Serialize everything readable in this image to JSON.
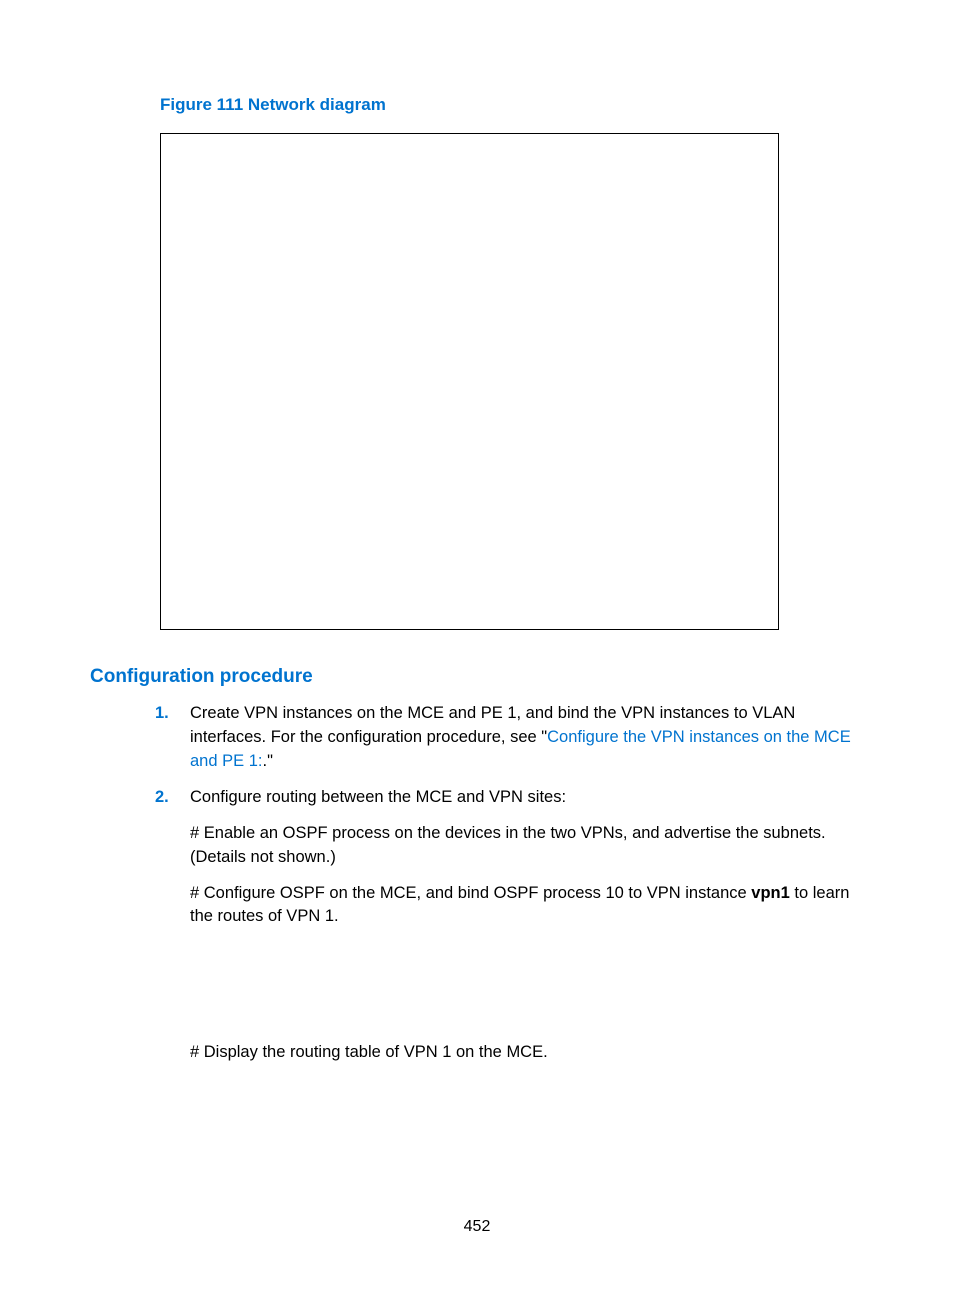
{
  "figure": {
    "caption": "Figure 111 Network diagram"
  },
  "section_heading": "Configuration procedure",
  "steps": {
    "one": {
      "num": "1.",
      "prefix": "Create VPN instances on the MCE and PE 1, and bind the VPN instances to VLAN interfaces. For the configuration procedure, see \"",
      "link_text": "Configure the VPN instances on the MCE and PE 1:",
      "suffix": ".\""
    },
    "two": {
      "num": "2.",
      "intro": "Configure routing between the MCE and VPN sites:",
      "p1": "# Enable an OSPF process on the devices in the two VPNs, and advertise the subnets. (Details not shown.)",
      "p2_prefix": "# Configure OSPF on the MCE, and bind OSPF process 10 to VPN instance ",
      "p2_bold": "vpn1",
      "p2_suffix": " to learn the routes of VPN 1.",
      "p3": "# Display the routing table of VPN 1 on the MCE."
    }
  },
  "page_number": "452"
}
